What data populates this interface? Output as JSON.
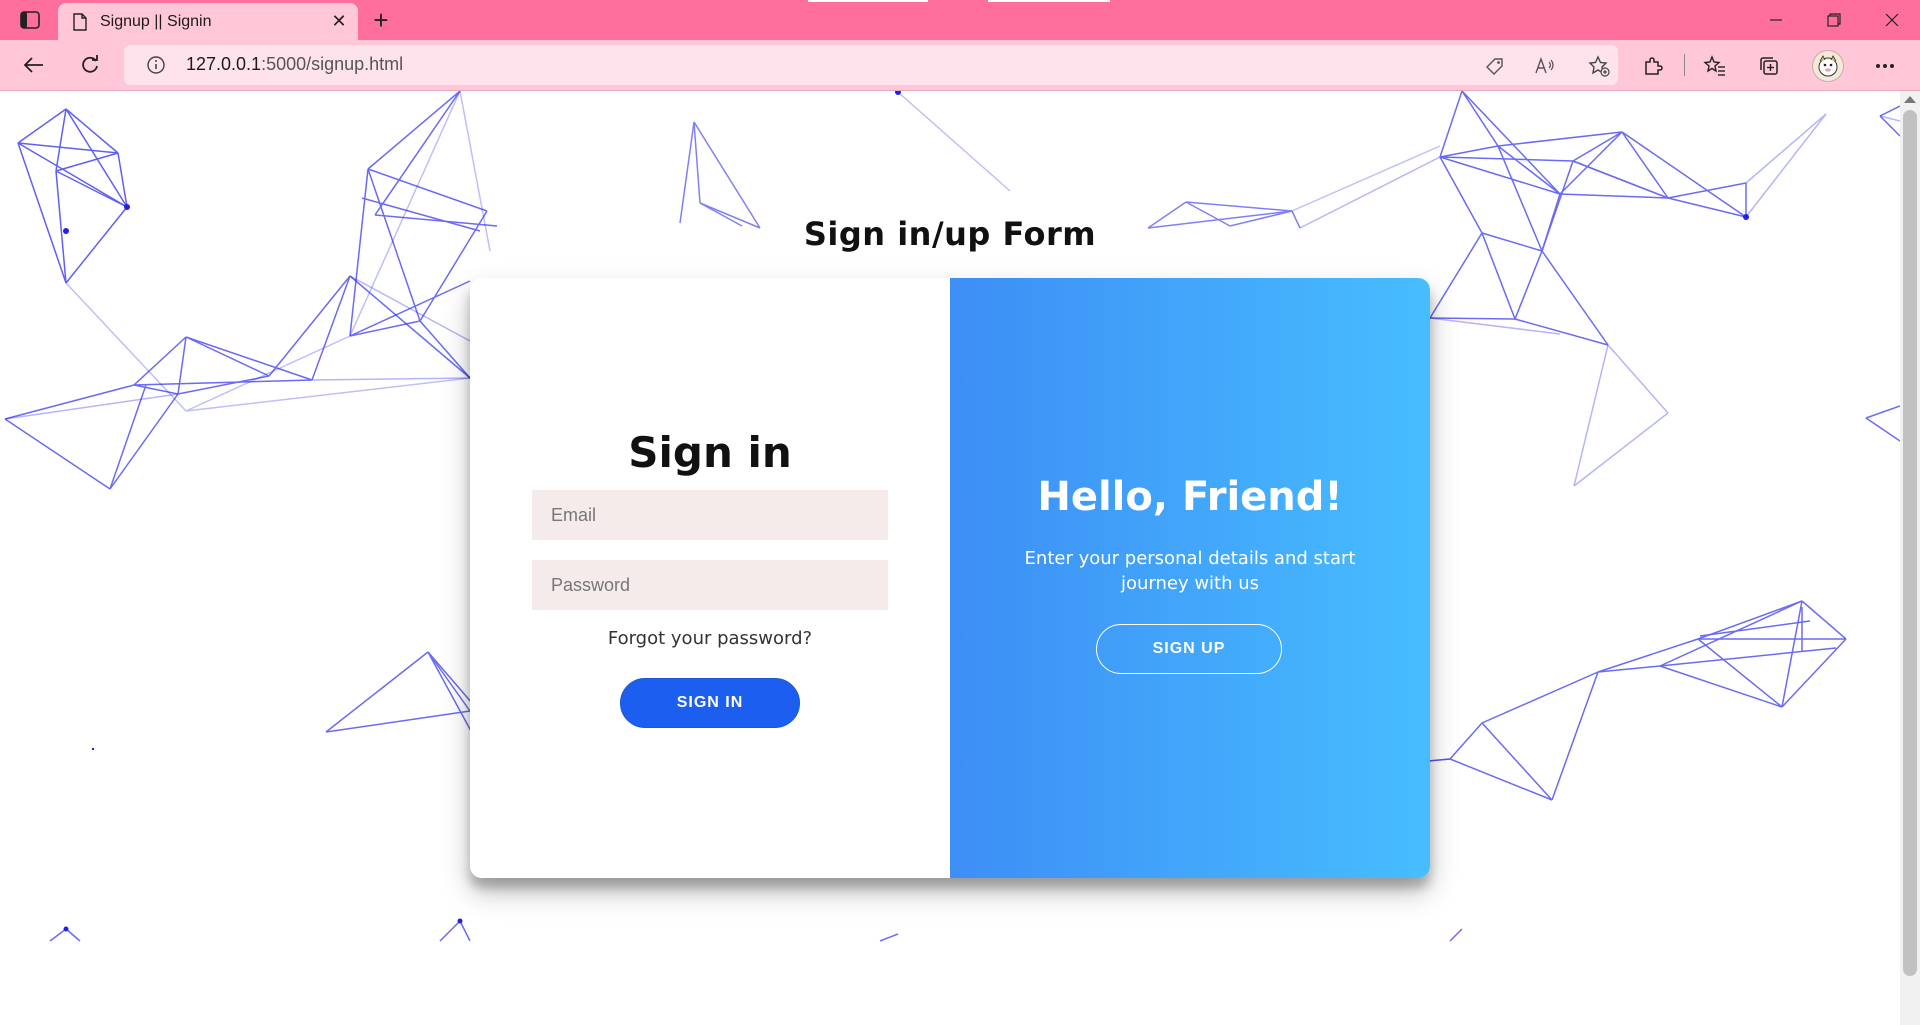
{
  "browser": {
    "tab": {
      "title": "Signup || Signin",
      "close_glyph": "✕"
    },
    "new_tab_glyph": "+",
    "address": {
      "host": "127.0.0.1",
      "path": ":5000/signup.html"
    },
    "window_controls": {
      "minimize": "—",
      "restore": "❐",
      "close": "✕"
    },
    "icons": [
      "sidebar-icon",
      "page-icon",
      "back-icon",
      "refresh-icon",
      "info-icon",
      "tag-icon",
      "read-aloud-icon",
      "add-favorite-icon",
      "extensions-icon",
      "favorites-icon",
      "collections-icon",
      "profile-avatar",
      "more-icon"
    ],
    "theme_colors": {
      "tabbar": "#ff6f9e",
      "toolbar": "#ffc7d8"
    }
  },
  "page": {
    "heading": "Sign in/up Form",
    "signin": {
      "title": "Sign in",
      "email_placeholder": "Email",
      "password_placeholder": "Password",
      "forgot": "Forgot your password?",
      "button": "SIGN IN"
    },
    "overlay": {
      "title": "Hello, Friend!",
      "text": "Enter your personal details and start journey with us",
      "button": "SIGN UP"
    },
    "colors": {
      "accent": "#1c5ff0",
      "overlay_start": "#3d8ef5",
      "overlay_end": "#47bdff",
      "network_lines": "#2c2cf0",
      "input_bg": "#f4ebea"
    }
  }
}
